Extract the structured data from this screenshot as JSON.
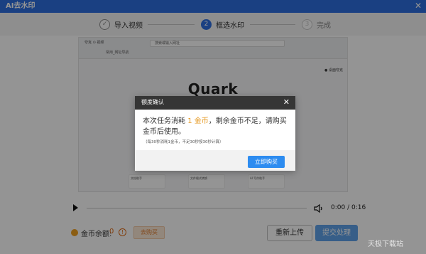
{
  "window": {
    "title": "AI去水印",
    "close_glyph": "✕"
  },
  "steps": [
    {
      "index": "✓",
      "label": "导入视频",
      "state": "done"
    },
    {
      "index": "2",
      "label": "框选水印",
      "state": "active"
    },
    {
      "index": "3",
      "label": "完成",
      "state": "pending"
    }
  ],
  "preview": {
    "browser": {
      "tab_text": "夸克 ⊙ 视频",
      "url_text": "搜索或输入网址",
      "bookmark_text": "常用_网址导航"
    },
    "quark_link": "● 桌面夸克",
    "logo_text": "Quark",
    "cards": [
      "文档助手",
      "文件格式转换",
      "AI 写作助手"
    ]
  },
  "player": {
    "time": "0:00 / 0:16"
  },
  "bottom": {
    "coin_label": "金币余额:",
    "coin_value": "0",
    "info_glyph": "!",
    "buy_coins_label": "去购买",
    "reupload_label": "重新上传",
    "submit_label": "提交处理"
  },
  "modal": {
    "title": "额度确认",
    "close_glyph": "✕",
    "text_before": "本次任务消耗 ",
    "cost": "1 金币",
    "text_after": "，剩余金币不足，请购买金币后使用。",
    "note": "（每30秒消耗1金币，不足30秒按30秒计算）",
    "buy_now_label": "立即购买"
  },
  "watermark": "天极下载站",
  "colors": {
    "primary": "#2d6fe0",
    "accent_orange": "#e69a23",
    "modal_header": "#353535"
  }
}
